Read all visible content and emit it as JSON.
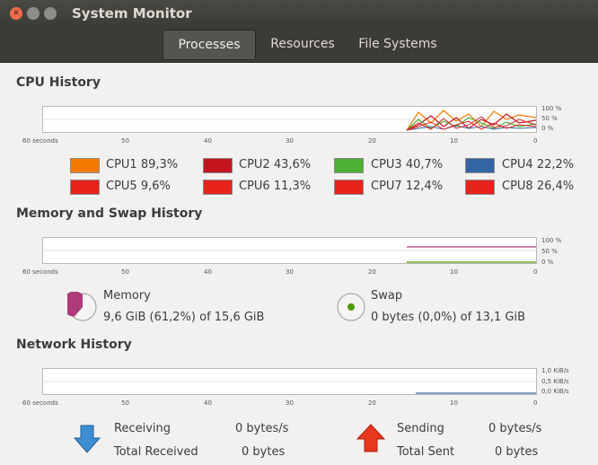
{
  "window": {
    "title": "System Monitor"
  },
  "tabs": [
    {
      "label": "Processes",
      "active": true
    },
    {
      "label": "Resources",
      "active": false
    },
    {
      "label": "File Systems",
      "active": false
    }
  ],
  "time_axis": [
    "60 seconds",
    "50",
    "40",
    "30",
    "20",
    "10",
    "0"
  ],
  "cpu": {
    "title": "CPU History",
    "scale": [
      "100 %",
      "50 %",
      "0 %"
    ],
    "cores": [
      {
        "name": "CPU1",
        "value": "89,3%",
        "color": "#f57900"
      },
      {
        "name": "CPU2",
        "value": "43,6%",
        "color": "#c4151f"
      },
      {
        "name": "CPU3",
        "value": "40,7%",
        "color": "#4caf36"
      },
      {
        "name": "CPU4",
        "value": "22,2%",
        "color": "#3465a4"
      },
      {
        "name": "CPU5",
        "value": "9,6%",
        "color": "#e8231c"
      },
      {
        "name": "CPU6",
        "value": "11,3%",
        "color": "#e8231c"
      },
      {
        "name": "CPU7",
        "value": "12,4%",
        "color": "#e8231c"
      },
      {
        "name": "CPU8",
        "value": "26,4%",
        "color": "#e8231c"
      }
    ]
  },
  "memory": {
    "title": "Memory and Swap History",
    "scale": [
      "100 %",
      "50 %",
      "0 %"
    ],
    "memory_label": "Memory",
    "memory_value": "9,6 GiB (61,2%) of 15,6 GiB",
    "memory_fraction": 0.612,
    "memory_color": "#ad3b78",
    "swap_label": "Swap",
    "swap_value": "0 bytes (0,0%) of 13,1 GiB",
    "swap_fraction": 0.0,
    "swap_color": "#4e9a06"
  },
  "network": {
    "title": "Network History",
    "scale": [
      "1,0 KiB/s",
      "0,5 KiB/s",
      "0,0 KiB/s"
    ],
    "receiving_label": "Receiving",
    "receiving_value": "0 bytes/s",
    "total_received_label": "Total Received",
    "total_received_value": "0 bytes",
    "sending_label": "Sending",
    "sending_value": "0 bytes/s",
    "total_sent_label": "Total Sent",
    "total_sent_value": "0 bytes",
    "receiving_color": "#3465a4",
    "sending_color": "#e8231c"
  }
}
